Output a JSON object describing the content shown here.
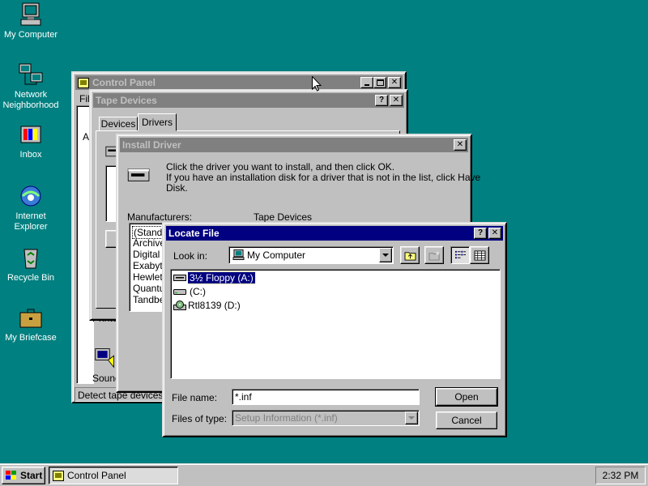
{
  "desktop": {
    "icons": [
      {
        "label": "My Computer",
        "icon": "computer-icon"
      },
      {
        "label": "Network Neighborhood",
        "icon": "network-icon"
      },
      {
        "label": "Inbox",
        "icon": "inbox-icon"
      },
      {
        "label": "Internet Explorer",
        "icon": "internet-explorer-icon"
      },
      {
        "label": "Recycle Bin",
        "icon": "recycle-bin-icon"
      },
      {
        "label": "My Briefcase",
        "icon": "briefcase-icon"
      }
    ]
  },
  "control_panel": {
    "title": "Control Panel",
    "menu_fragment": "Fil",
    "side_fragment": "A",
    "printers_fragment": "Printe",
    "sounds_fragment": "Sound",
    "status": "Detect tape devices a"
  },
  "tape_devices": {
    "title": "Tape Devices",
    "tabs": [
      "Devices",
      "Drivers"
    ],
    "active_tab": "Drivers"
  },
  "install_driver": {
    "title": "Install Driver",
    "instruction_line1": "Click the driver you want to install, and then click OK.",
    "instruction_line2": "If you have an installation disk for a driver that is not in the list, click Have",
    "instruction_line3": "Disk.",
    "manufacturers_label": "Manufacturers:",
    "devices_label": "Tape Devices",
    "manufacturers": [
      "(Standa",
      "Archive",
      "Digital",
      "Exabyte",
      "Hewlet",
      "Quantu",
      "Tandbe"
    ]
  },
  "locate_file": {
    "title": "Locate File",
    "look_in_label": "Look in:",
    "look_in_value": "My Computer",
    "items": [
      {
        "label": "3½ Floppy (A:)",
        "icon": "floppy-drive-icon",
        "selected": true
      },
      {
        "label": "(C:)",
        "icon": "hard-drive-icon",
        "selected": false
      },
      {
        "label": "Rtl8139 (D:)",
        "icon": "cd-drive-icon",
        "selected": false
      }
    ],
    "file_name_label": "File name:",
    "file_name_value": "*.inf",
    "files_of_type_label": "Files of type:",
    "files_of_type_value": "Setup Information (*.inf)",
    "open_label": "Open",
    "cancel_label": "Cancel"
  },
  "taskbar": {
    "start_label": "Start",
    "task_label": "Control Panel",
    "clock": "2:32 PM"
  },
  "colors": {
    "desktop": "#008080",
    "active_title": "#000080",
    "inactive_title": "#808080",
    "face": "#c0c0c0"
  }
}
